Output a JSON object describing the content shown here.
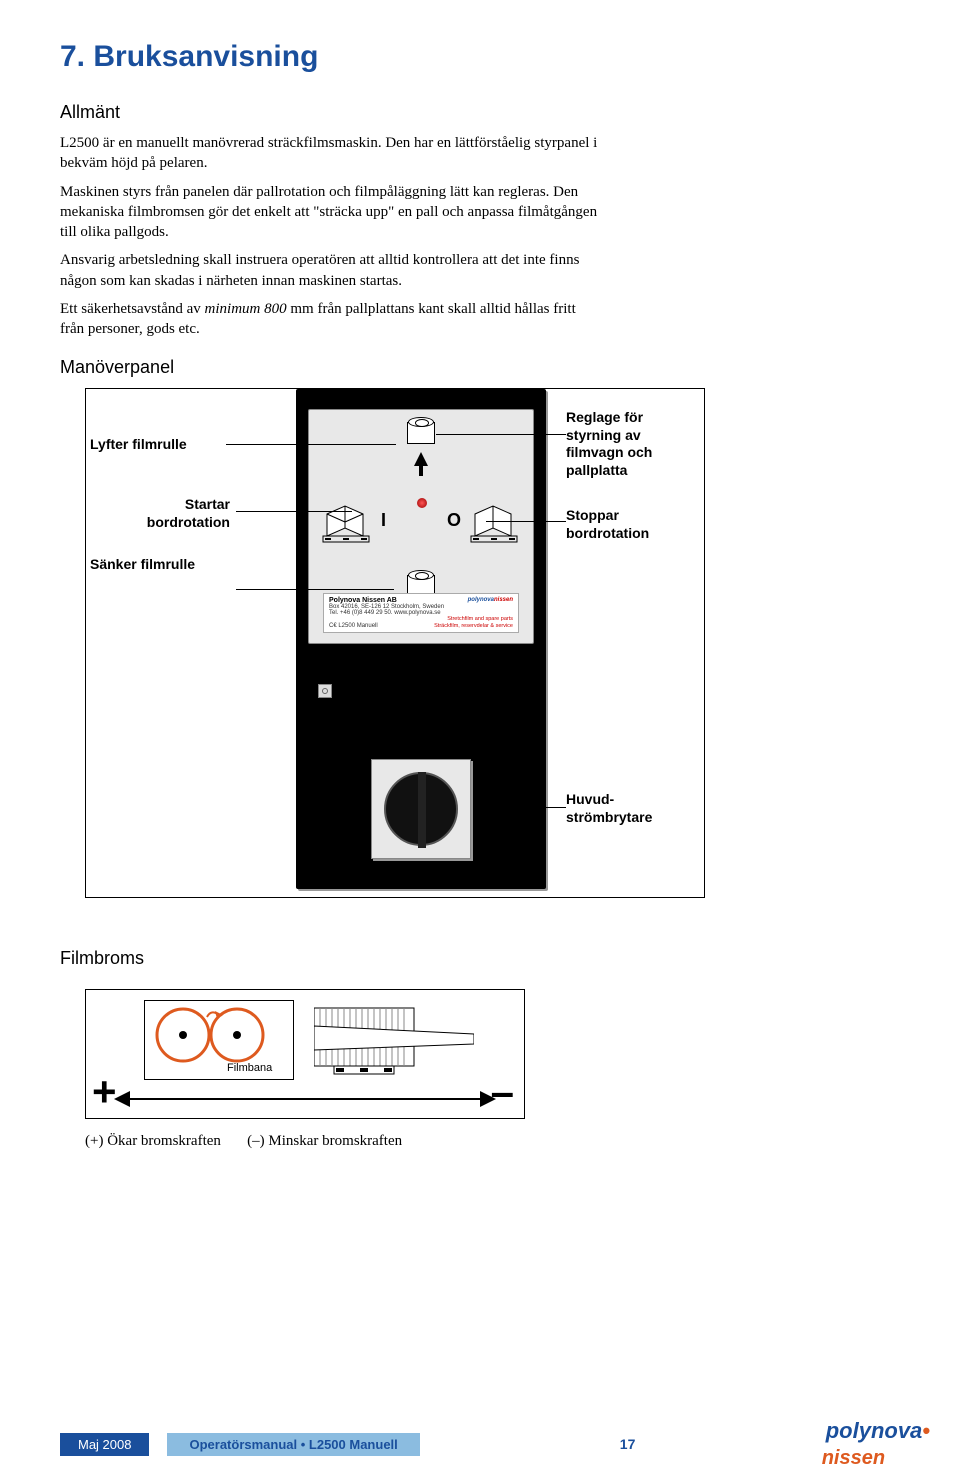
{
  "title": "7.  Bruksanvisning",
  "h_allmant": "Allmänt",
  "p1": "L2500 är en manuellt manövrerad sträckfilmsmaskin. Den har en lättförståelig styrpanel i bekväm höjd på pelaren.",
  "p2": "Maskinen styrs från panelen där pallrotation och filmpåläggning lätt kan regleras. Den mekaniska filmbromsen gör det enkelt att \"sträcka upp\" en pall och anpassa filmåtgången till olika pallgods.",
  "p3": "Ansvarig arbetsledning skall instruera operatören att alltid kontrollera att det inte finns någon som kan skadas i närheten innan maskinen startas.",
  "p4a": "Ett säkerhetsavstånd av ",
  "p4i": "minimum 800",
  "p4b": " mm från pallplattans kant skall alltid hållas fritt från personer, gods etc.",
  "h_panel": "Manöverpanel",
  "callouts": {
    "lyfter": "Lyfter filmrulle",
    "reglage": "Reglage för styrning av filmvagn och pallplatta",
    "startar": "Startar bordrotation",
    "stoppar": "Stoppar bordrotation",
    "sanker": "Sänker filmrulle",
    "huvud": "Huvud-\nströmbrytare"
  },
  "nameplate": {
    "company": "Polynova Nissen AB",
    "addr": "Box 42016, SE-126 12 Stockholm, Sweden",
    "tel": "Tel. +46 (0)8 449 29 50.  www.polynova.se",
    "model": "L2500 Manuell",
    "tag1": "Stretchfilm and spare parts",
    "tag2": "Sträckfilm, reservdelar & service"
  },
  "h_filmbroms": "Filmbroms",
  "filmbana": "Filmbana",
  "plus": "+",
  "minus": "–",
  "caption_plus": "(+) Ökar bromskraften",
  "caption_minus": "(–) Minskar bromskraften",
  "footer": {
    "date": "Maj 2008",
    "doc": "Operatörsmanual • L2500 Manuell",
    "page": "17",
    "logo_p": "polynova",
    "logo_n": "nissen"
  },
  "chart_data": {
    "type": "table",
    "title": "Manöverpanel — reglage",
    "rows": [
      {
        "control": "Pilknapp upp (rulle-ikon ↑)",
        "function": "Lyfter filmrulle"
      },
      {
        "control": "Knapp  I  (med pall-ikon)",
        "function": "Startar bordrotation"
      },
      {
        "control": "Knapp  O  (med pall-ikon)",
        "function": "Stoppar bordrotation"
      },
      {
        "control": "Pilknapp ner (rulle-ikon ↓)",
        "function": "Sänker filmrulle"
      },
      {
        "control": "Vred (svart ratt)",
        "function": "Huvudströmbrytare"
      },
      {
        "control": "Översta reglageplatta",
        "function": "Reglage för styrning av filmvagn och pallplatta"
      }
    ]
  }
}
